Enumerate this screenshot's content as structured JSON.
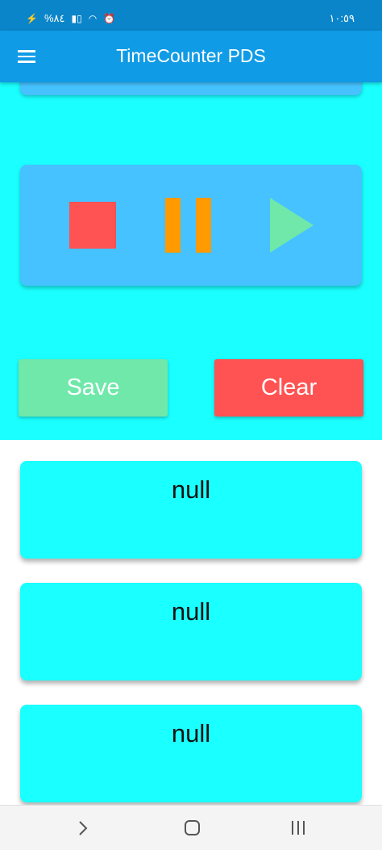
{
  "status_bar": {
    "left_text": "%٨٤",
    "time": "١٠:٥٩",
    "icons": [
      "battery-charging-icon",
      "signal-icon",
      "wifi-icon",
      "alarm-icon"
    ]
  },
  "app_bar": {
    "title": "TimeCounter PDS",
    "menu_icon": "hamburger-menu-icon"
  },
  "controls": {
    "stop_icon": "stop-icon",
    "pause_icon": "pause-icon",
    "play_icon": "play-icon"
  },
  "buttons": {
    "save_label": "Save",
    "clear_label": "Clear"
  },
  "records": [
    {
      "text": "null"
    },
    {
      "text": "null"
    },
    {
      "text": "null"
    }
  ],
  "nav_bar": {
    "icons": [
      "back-icon",
      "home-icon",
      "recents-icon"
    ]
  },
  "colors": {
    "app_bar": "#0f9be6",
    "status_bar": "#0b85c9",
    "background_cyan": "#1affff",
    "control_card": "#45c2ff",
    "stop": "#ff5252",
    "pause": "#ff9a00",
    "play": "#6fe8aa",
    "save": "#6fe8aa",
    "clear": "#ff5252"
  }
}
